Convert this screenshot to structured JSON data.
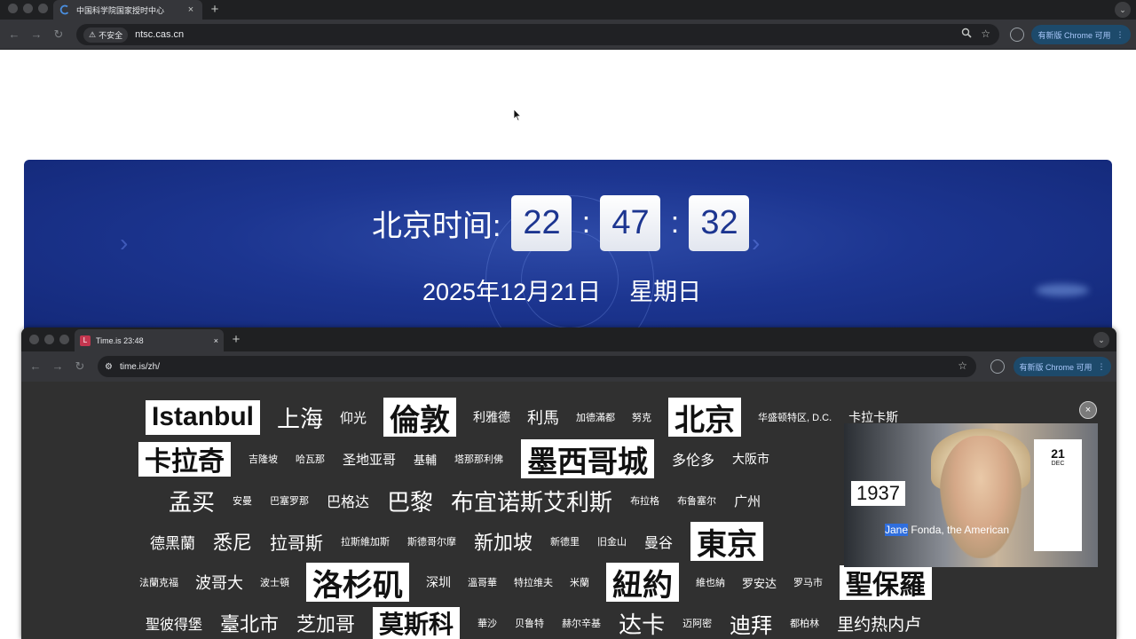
{
  "outer_browser": {
    "tab_title": "中国科学院国家授时中心",
    "tab_close": "×",
    "new_tab": "+",
    "strip_menu": "⌄",
    "security_label": "不安全",
    "url": "ntsc.cas.cn",
    "update_label": "有新版 Chrome 可用"
  },
  "ntsc": {
    "clock_label": "北京时间:",
    "hours": "22",
    "minutes": "47",
    "seconds": "32",
    "colon": ":",
    "date": "2025年12月21日",
    "weekday": "星期日"
  },
  "inner_browser": {
    "tab_title": "Time.is 23:48",
    "tab_close": "×",
    "new_tab": "+",
    "strip_menu": "⌄",
    "favicon_letter": "L",
    "url": "time.is/zh/",
    "update_label": "有新版 Chrome 可用"
  },
  "city_rows": [
    [
      {
        "name": "Istanbul",
        "size": 30,
        "hl": true
      },
      {
        "name": "上海",
        "size": 26
      },
      {
        "name": "仰光",
        "size": 15
      },
      {
        "name": "倫敦",
        "size": 34,
        "hl": true
      },
      {
        "name": "利雅德",
        "size": 14
      },
      {
        "name": "利馬",
        "size": 18
      },
      {
        "name": "加德滿都",
        "size": 11
      },
      {
        "name": "努克",
        "size": 11
      },
      {
        "name": "北京",
        "size": 34,
        "hl": true
      },
      {
        "name": "华盛顿特区, D.C.",
        "size": 11
      },
      {
        "name": "卡拉卡斯",
        "size": 14
      }
    ],
    [
      {
        "name": "卡拉奇",
        "size": 30,
        "hl": true
      },
      {
        "name": "吉隆坡",
        "size": 11
      },
      {
        "name": "哈瓦那",
        "size": 11
      },
      {
        "name": "圣地亚哥",
        "size": 15
      },
      {
        "name": "基輔",
        "size": 13
      },
      {
        "name": "塔那那利佛",
        "size": 11
      },
      {
        "name": "墨西哥城",
        "size": 34,
        "hl": true
      },
      {
        "name": "多伦多",
        "size": 16
      },
      {
        "name": "大阪市",
        "size": 14
      }
    ],
    [
      {
        "name": "孟买",
        "size": 26
      },
      {
        "name": "安曼",
        "size": 11
      },
      {
        "name": "巴塞罗那",
        "size": 11
      },
      {
        "name": "巴格达",
        "size": 16
      },
      {
        "name": "巴黎",
        "size": 26
      },
      {
        "name": "布宜诺斯艾利斯",
        "size": 26
      },
      {
        "name": "布拉格",
        "size": 11
      },
      {
        "name": "布鲁塞尔",
        "size": 11
      },
      {
        "name": "广州",
        "size": 15
      }
    ],
    [
      {
        "name": "德黑蘭",
        "size": 17
      },
      {
        "name": "悉尼",
        "size": 22
      },
      {
        "name": "拉哥斯",
        "size": 20
      },
      {
        "name": "拉斯維加斯",
        "size": 11
      },
      {
        "name": "斯德哥尔摩",
        "size": 11
      },
      {
        "name": "新加坡",
        "size": 22
      },
      {
        "name": "新德里",
        "size": 11
      },
      {
        "name": "旧金山",
        "size": 11
      },
      {
        "name": "曼谷",
        "size": 16
      },
      {
        "name": "東京",
        "size": 34,
        "hl": true
      }
    ],
    [
      {
        "name": "法蘭克福",
        "size": 11
      },
      {
        "name": "波哥大",
        "size": 18
      },
      {
        "name": "波士頓",
        "size": 11
      },
      {
        "name": "洛杉矶",
        "size": 34,
        "hl": true
      },
      {
        "name": "深圳",
        "size": 14
      },
      {
        "name": "溫哥華",
        "size": 11
      },
      {
        "name": "特拉维夫",
        "size": 11
      },
      {
        "name": "米蘭",
        "size": 11
      },
      {
        "name": "紐約",
        "size": 34,
        "hl": true
      },
      {
        "name": "維也納",
        "size": 11
      },
      {
        "name": "罗安达",
        "size": 13
      },
      {
        "name": "罗马市",
        "size": 11
      },
      {
        "name": "聖保羅",
        "size": 30,
        "hl": true
      }
    ],
    [
      {
        "name": "聖彼得堡",
        "size": 16
      },
      {
        "name": "臺北市",
        "size": 22
      },
      {
        "name": "芝加哥",
        "size": 22
      },
      {
        "name": "莫斯科",
        "size": 28,
        "hl": true
      },
      {
        "name": "華沙",
        "size": 11
      },
      {
        "name": "贝鲁特",
        "size": 11
      },
      {
        "name": "赫尔辛基",
        "size": 11
      },
      {
        "name": "达卡",
        "size": 26
      },
      {
        "name": "迈阿密",
        "size": 11
      },
      {
        "name": "迪拜",
        "size": 24
      },
      {
        "name": "都柏林",
        "size": 11
      },
      {
        "name": "里约热内卢",
        "size": 19
      }
    ]
  ],
  "video_popup": {
    "year": "1937",
    "day": "21",
    "month": "DEC",
    "caption_highlight": "Jane",
    "caption_rest": " Fonda, the American",
    "close_label": "×"
  }
}
